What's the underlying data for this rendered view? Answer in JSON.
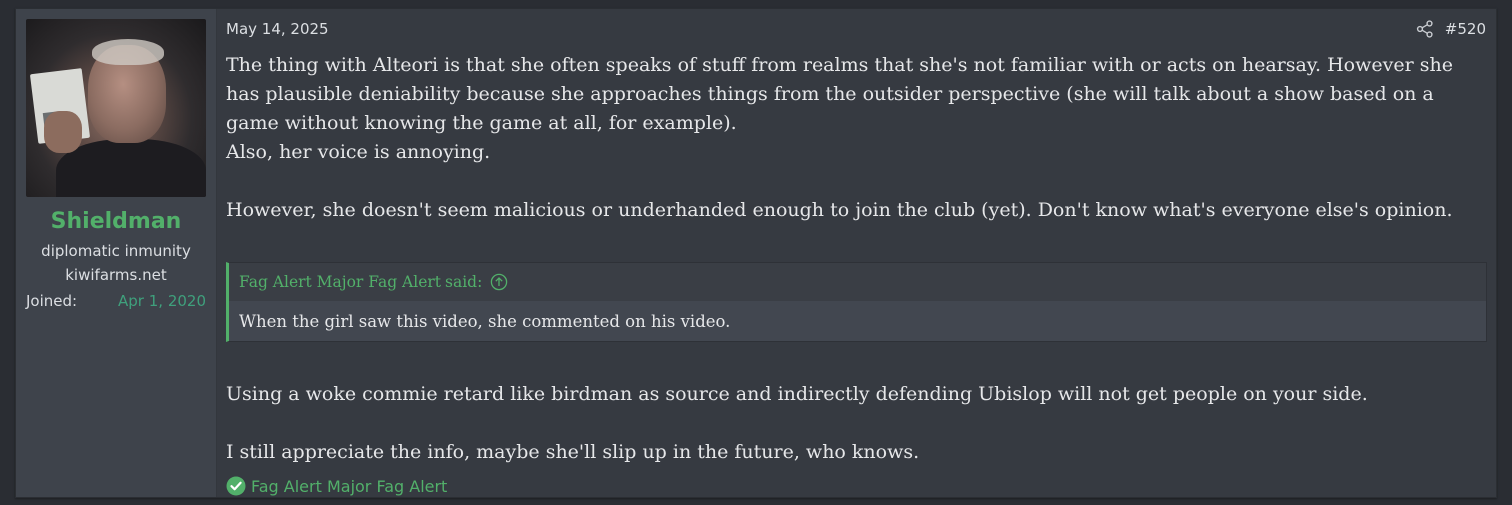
{
  "user": {
    "username": "Shieldman",
    "title_line1": "diplomatic inmunity",
    "title_line2": "kiwifarms.net",
    "joined_label": "Joined:",
    "joined_value": "Apr 1, 2020"
  },
  "post": {
    "date": "May 14, 2025",
    "number": "#520",
    "paragraphs_top": [
      "The thing with Alteori is that she often speaks of stuff from realms that she's not familiar with or acts on hearsay. However she has plausible deniability because she approaches things from the outsider perspective (she will talk about a show based on a game without knowing the game at all, for example).",
      "Also, her voice is annoying.",
      "However, she doesn't seem malicious or underhanded enough to join the club (yet). Don't know what's everyone else's opinion."
    ],
    "quote": {
      "author": "Fag Alert Major Fag Alert",
      "said": "said:",
      "text": "When the girl saw this video, she commented on his video."
    },
    "paragraphs_bottom": [
      "Using a woke commie retard like birdman as source and indirectly defending Ubislop will not get people on your side.",
      "I still appreciate the info, maybe she'll slip up in the future, who knows."
    ]
  },
  "reaction": {
    "icon": "check-circle-icon",
    "name": "Fag Alert Major Fag Alert"
  },
  "colors": {
    "accent": "#52b06a",
    "joined_value": "#3fa07c",
    "post_bg": "#363a41",
    "user_col_bg": "#3e434b"
  }
}
